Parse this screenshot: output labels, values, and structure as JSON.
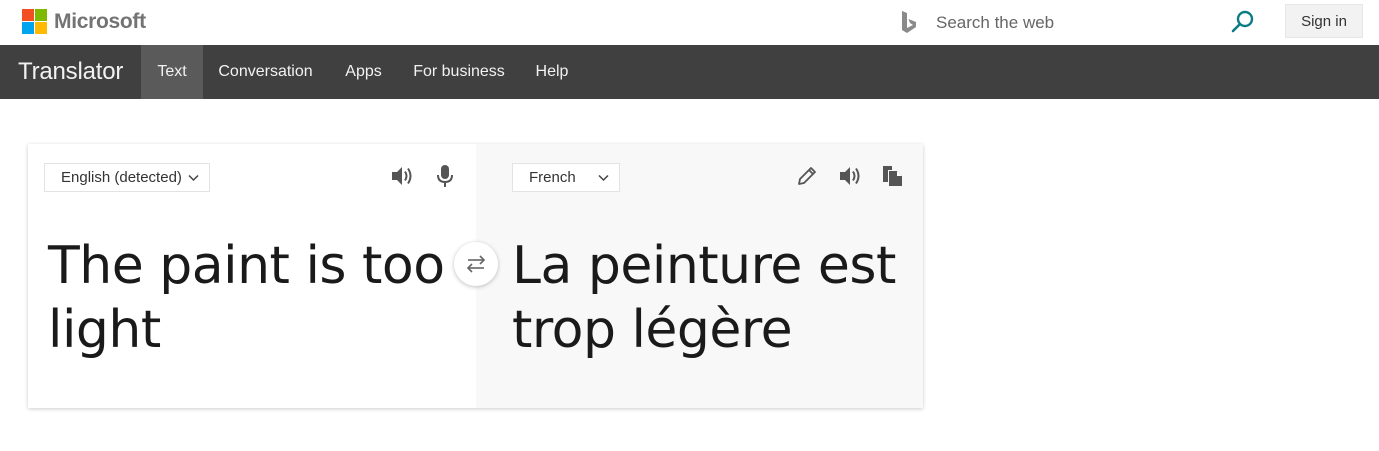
{
  "header": {
    "brand_name": "Microsoft",
    "search": {
      "placeholder": "Search the web",
      "value": ""
    },
    "signin_label": "Sign in",
    "colors": {
      "logo_red": "#f25022",
      "logo_green": "#7fba00",
      "logo_blue": "#00a4ef",
      "logo_yellow": "#ffb900",
      "search_icon": "#0c7c84"
    }
  },
  "nav": {
    "brand": "Translator",
    "items": [
      {
        "label": "Text",
        "active": true
      },
      {
        "label": "Conversation",
        "active": false
      },
      {
        "label": "Apps",
        "active": false
      },
      {
        "label": "For business",
        "active": false
      },
      {
        "label": "Help",
        "active": false
      }
    ]
  },
  "translator": {
    "source": {
      "language": "English (detected)",
      "text": "The paint is too light"
    },
    "target": {
      "language": "French",
      "text": "La peinture est trop légère"
    },
    "icons": {
      "source": [
        "speaker-icon",
        "microphone-icon"
      ],
      "target": [
        "pencil-icon",
        "speaker-icon",
        "copy-icon"
      ],
      "swap": "swap-arrows-icon"
    }
  }
}
